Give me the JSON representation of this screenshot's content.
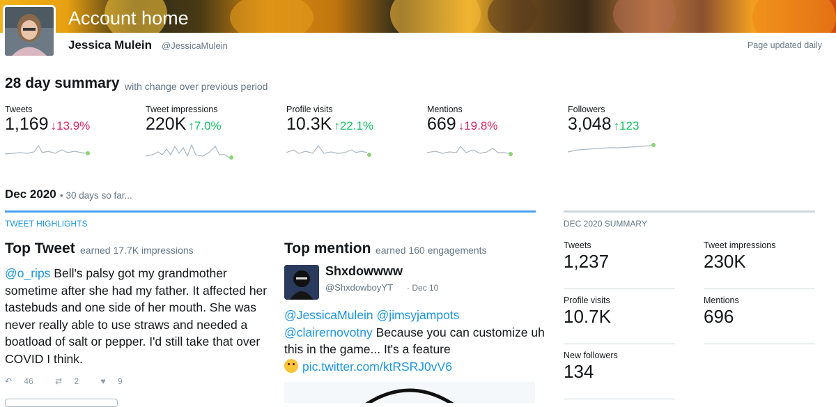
{
  "header": {
    "page_title": "Account home",
    "user_name": "Jessica Mulein",
    "user_handle": "@JessicaMulein",
    "page_updated": "Page updated daily"
  },
  "summary": {
    "title": "28 day summary",
    "subtitle": "with change over previous period",
    "metrics": [
      {
        "label": "Tweets",
        "value": "1,169",
        "change": "13.9%",
        "direction": "down"
      },
      {
        "label": "Tweet impressions",
        "value": "220K",
        "change": "7.0%",
        "direction": "up"
      },
      {
        "label": "Profile visits",
        "value": "10.3K",
        "change": "22.1%",
        "direction": "up"
      },
      {
        "label": "Mentions",
        "value": "669",
        "change": "19.8%",
        "direction": "down"
      },
      {
        "label": "Followers",
        "value": "3,048",
        "change": "123",
        "direction": "up"
      }
    ]
  },
  "month": {
    "title": "Dec 2020",
    "subtitle": "• 30 days so far..."
  },
  "highlights": {
    "section_label": "TWEET HIGHLIGHTS",
    "top_tweet": {
      "title": "Top Tweet",
      "subtitle": "earned 17.7K impressions",
      "mention": "@o_rips",
      "text": " Bell's palsy got my grandmother sometime after she had my father. It affected her tastebuds and one side of her mouth. She was never really able to use straws and needed a boatload of salt or pepper. I'd still take that over COVID I think.",
      "replies": "46",
      "retweets": "2",
      "likes": "9"
    },
    "top_mention": {
      "title": "Top mention",
      "subtitle": "earned 160 engagements",
      "name": "Shxdowwww",
      "handle": "@ShxdowboyYT",
      "date": "· Dec 10",
      "mention1": "@JessicaMulein",
      "mention2": "@jimsyjampots",
      "mention3": "@clairernovotny",
      "text": " Because you can customize uh this in the game... It's a feature",
      "link": "pic.twitter.com/ktRSRJ0vV6"
    }
  },
  "dec_summary": {
    "section_label": "DEC 2020 SUMMARY",
    "items": [
      {
        "label": "Tweets",
        "value": "1,237"
      },
      {
        "label": "Tweet impressions",
        "value": "230K"
      },
      {
        "label": "Profile visits",
        "value": "10.7K"
      },
      {
        "label": "Mentions",
        "value": "696"
      },
      {
        "label": "New followers",
        "value": "134"
      }
    ]
  },
  "colors": {
    "link": "#1b95e0",
    "up": "#17bf63",
    "down": "#e0245e",
    "accent_bar": "#4aa1eb"
  }
}
